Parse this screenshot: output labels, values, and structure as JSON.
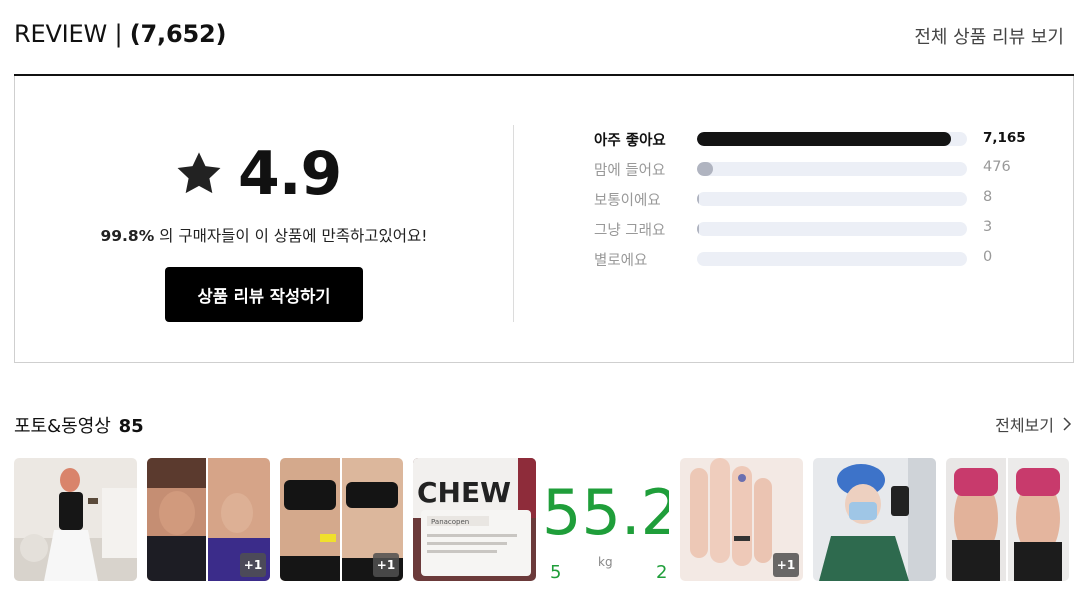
{
  "header": {
    "title_prefix": "REVIEW | ",
    "title_count": "(7,652)",
    "view_all": "전체 상품 리뷰 보기"
  },
  "summary": {
    "score": "4.9",
    "satisfaction_pct": "99.8%",
    "satisfaction_text": " 의 구매자들이 이 상품에 만족하고있어요!",
    "write_button": "상품 리뷰 작성하기",
    "distribution": [
      {
        "label": "아주 좋아요",
        "count": "7,165",
        "fraction": 0.94
      },
      {
        "label": "맘에 들어요",
        "count": "476",
        "fraction": 0.062
      },
      {
        "label": "보통이에요",
        "count": "8",
        "fraction": 0.001
      },
      {
        "label": "그냥 그래요",
        "count": "3",
        "fraction": 0.0004
      },
      {
        "label": "별로에요",
        "count": "0",
        "fraction": 0
      }
    ]
  },
  "photos": {
    "title": "포토&동영상",
    "count": "85",
    "view_all": "전체보기",
    "thumb5_big": "55.2",
    "thumb5_left": "5",
    "thumb5_unit": "kg",
    "thumb5_right": "2",
    "thumb4_text": "CHEW",
    "thumb4_brand": "Panacopen",
    "badges": [
      "+1",
      "+1",
      "+1"
    ]
  },
  "colors": {
    "accent_black": "#111111",
    "bar_track": "#eceff6",
    "bar_gray": "#b0b4c0"
  }
}
